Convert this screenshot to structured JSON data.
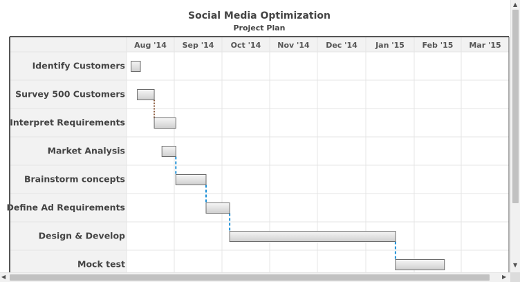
{
  "chart_data": {
    "type": "gantt",
    "title": "Social Media Optimization",
    "subtitle": "Project Plan",
    "months": [
      "Aug '14",
      "Sep '14",
      "Oct '14",
      "Nov '14",
      "Dec '14",
      "Jan '15",
      "Feb '15",
      "Mar '15"
    ],
    "tasks": [
      {
        "name": "Identify Customers",
        "start": "2014-08-04",
        "end": "2014-08-10"
      },
      {
        "name": "Survey 500 Customers",
        "start": "2014-08-08",
        "end": "2014-08-19"
      },
      {
        "name": "Interpret Requirements",
        "start": "2014-08-19",
        "end": "2014-09-02"
      },
      {
        "name": "Market Analysis",
        "start": "2014-08-24",
        "end": "2014-09-02"
      },
      {
        "name": "Brainstorm concepts",
        "start": "2014-09-02",
        "end": "2014-09-21"
      },
      {
        "name": "Define Ad Requirements",
        "start": "2014-09-21",
        "end": "2014-10-06"
      },
      {
        "name": "Design & Develop",
        "start": "2014-10-06",
        "end": "2015-01-20"
      },
      {
        "name": "Mock test",
        "start": "2015-01-20",
        "end": "2015-02-19"
      }
    ],
    "dependencies": [
      {
        "from": 1,
        "to": 2,
        "style": "dotted",
        "color": "#8b5a3c"
      },
      {
        "from": 3,
        "to": 4,
        "style": "dashed",
        "color": "#1e90d6"
      },
      {
        "from": 4,
        "to": 5,
        "style": "dashed",
        "color": "#1e90d6"
      },
      {
        "from": 5,
        "to": 6,
        "style": "dashed",
        "color": "#1e90d6"
      },
      {
        "from": 6,
        "to": 7,
        "style": "dashed",
        "color": "#1e90d6"
      }
    ],
    "grid": true
  },
  "colors": {
    "bar_top": "#f6f6f6",
    "bar_bottom": "#cfcfcf",
    "bar_border": "#6b6b6b",
    "label_bg": "#f2f2f2",
    "grid": "#e4e4e4",
    "frame": "#555555"
  },
  "icons": {
    "up": "scroll-up-arrow-icon",
    "down": "scroll-down-arrow-icon",
    "left": "scroll-left-arrow-icon",
    "right": "scroll-right-arrow-icon"
  }
}
